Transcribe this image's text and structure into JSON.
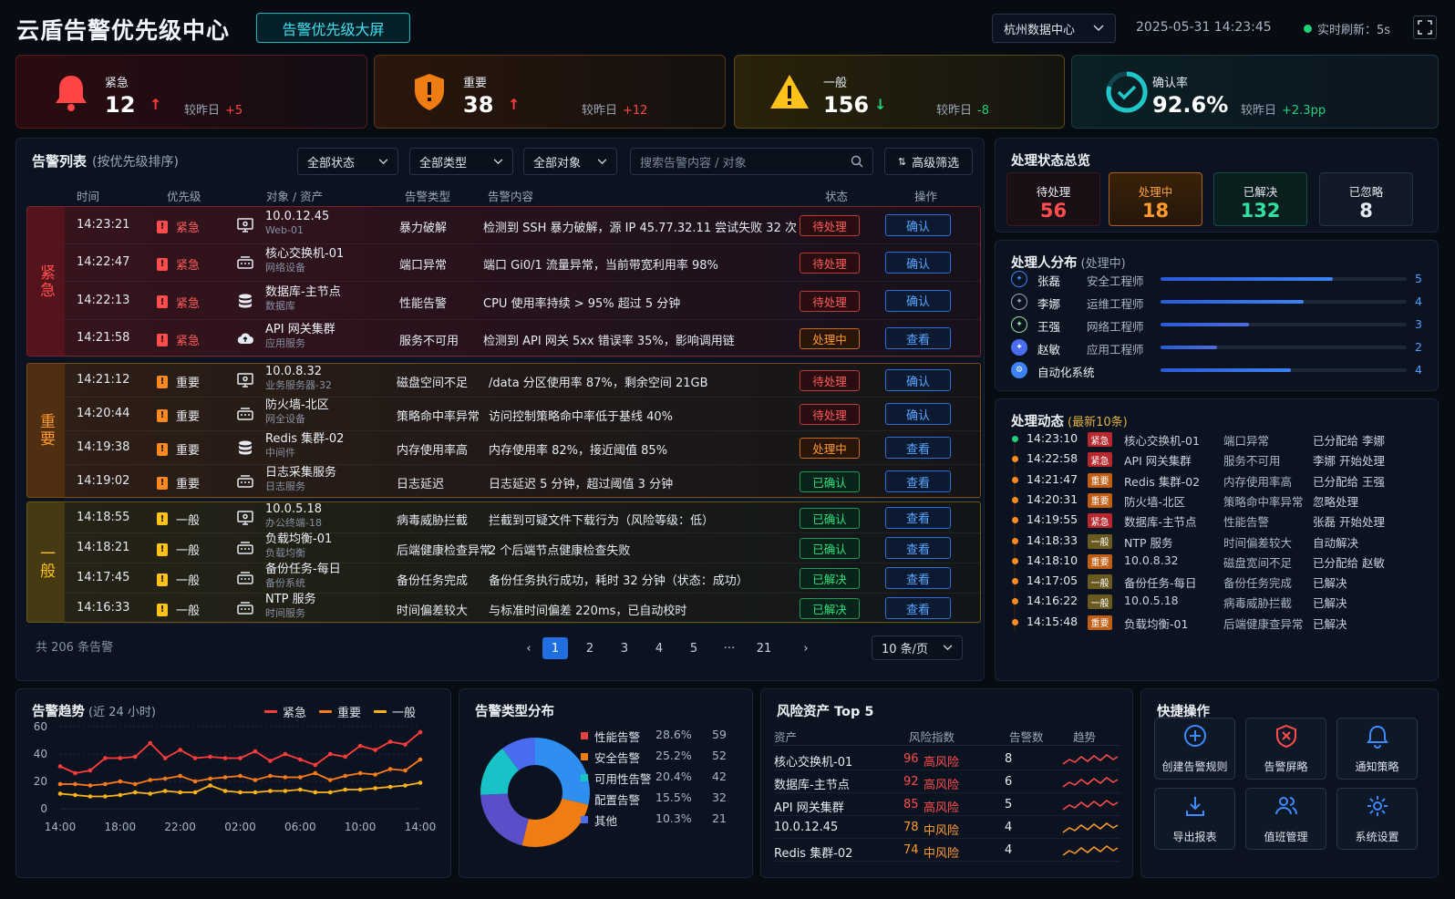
{
  "header": {
    "title": "云盾告警优先级中心",
    "badge": "告警优先级大屏",
    "datacenter": "杭州数据中心",
    "datetime": "2025-05-31 14:23:45",
    "refresh": "实时刷新：5s"
  },
  "kpis": [
    {
      "label": "紧急",
      "value": "12",
      "compare": "较昨日",
      "delta": "+5",
      "color": "#ff4d4d",
      "arrow": "↑"
    },
    {
      "label": "重要",
      "value": "38",
      "compare": "较昨日",
      "delta": "+12",
      "color": "#ff8a1f",
      "arrow": "↑"
    },
    {
      "label": "一般",
      "value": "156",
      "compare": "较昨日",
      "delta": "-8",
      "color": "#ffc21a",
      "arrow": "↓"
    },
    {
      "label": "确认率",
      "value": "92.6%",
      "compare": "较昨日",
      "delta": "+2.3pp",
      "color": "#1fc7c9",
      "arrow": ""
    }
  ],
  "alert_list": {
    "title": "告警列表",
    "subtitle": "(按优先级排序)",
    "filters": {
      "status": "全部状态",
      "type": "全部类型",
      "object": "全部对象",
      "search_placeholder": "搜索告警内容 / 对象",
      "advanced": "高级筛选"
    },
    "columns": {
      "time": "时间",
      "priority": "优先级",
      "object": "对象 / 资产",
      "type": "告警类型",
      "content": "告警内容",
      "status": "状态",
      "action": "操作"
    },
    "groups": [
      {
        "name": "紧急",
        "rows": [
          {
            "time": "14:23:21",
            "priority": "紧急",
            "object": "10.0.12.45",
            "sub": "Web-01",
            "type": "暴力破解",
            "content": "检测到 SSH 暴力破解，源 IP 45.77.32.11 尝试失败 32 次",
            "status": "待处理",
            "action": "确认"
          },
          {
            "time": "14:22:47",
            "priority": "紧急",
            "object": "核心交换机-01",
            "sub": "网络设备",
            "type": "端口异常",
            "content": "端口 Gi0/1 流量异常，当前带宽利用率 98%",
            "status": "待处理",
            "action": "确认"
          },
          {
            "time": "14:22:13",
            "priority": "紧急",
            "object": "数据库-主节点",
            "sub": "数据库",
            "type": "性能告警",
            "content": "CPU 使用率持续 > 95% 超过 5 分钟",
            "status": "待处理",
            "action": "确认"
          },
          {
            "time": "14:21:58",
            "priority": "紧急",
            "object": "API 网关集群",
            "sub": "应用服务",
            "type": "服务不可用",
            "content": "检测到 API 网关 5xx 错误率 35%，影响调用链",
            "status": "处理中",
            "action": "查看"
          }
        ]
      },
      {
        "name": "重要",
        "rows": [
          {
            "time": "14:21:12",
            "priority": "重要",
            "object": "10.0.8.32",
            "sub": "业务服务器-32",
            "type": "磁盘空间不足",
            "content": "/data 分区使用率 87%，剩余空间 21GB",
            "status": "待处理",
            "action": "确认"
          },
          {
            "time": "14:20:44",
            "priority": "重要",
            "object": "防火墙-北区",
            "sub": "网全设备",
            "type": "策略命中率异常",
            "content": "访问控制策略命中率低于基线 40%",
            "status": "待处理",
            "action": "确认"
          },
          {
            "time": "14:19:38",
            "priority": "重要",
            "object": "Redis 集群-02",
            "sub": "中间件",
            "type": "内存使用率高",
            "content": "内存使用率 82%，接近阈值 85%",
            "status": "处理中",
            "action": "查看"
          },
          {
            "time": "14:19:02",
            "priority": "重要",
            "object": "日志采集服务",
            "sub": "日志服务",
            "type": "日志延迟",
            "content": "日志延迟 5 分钟，超过阈值 3 分钟",
            "status": "已确认",
            "action": "查看"
          }
        ]
      },
      {
        "name": "一般",
        "rows": [
          {
            "time": "14:18:55",
            "priority": "一般",
            "object": "10.0.5.18",
            "sub": "办公终端-18",
            "type": "病毒威胁拦截",
            "content": "拦截到可疑文件下载行为（风险等级：低）",
            "status": "已确认",
            "action": "查看"
          },
          {
            "time": "14:18:21",
            "priority": "一般",
            "object": "负载均衡-01",
            "sub": "负载均衡",
            "type": "后端健康检查异常",
            "content": "2 个后端节点健康检查失败",
            "status": "已确认",
            "action": "查看"
          },
          {
            "time": "14:17:45",
            "priority": "一般",
            "object": "备份任务-每日",
            "sub": "备份系统",
            "type": "备份任务完成",
            "content": "备份任务执行成功，耗时 32 分钟（状态：成功）",
            "status": "已解决",
            "action": "查看"
          },
          {
            "time": "14:16:33",
            "priority": "一般",
            "object": "NTP 服务",
            "sub": "时间服务",
            "type": "时间偏差较大",
            "content": "与标准时间偏差 220ms，已自动校时",
            "status": "已解决",
            "action": "查看"
          }
        ]
      }
    ],
    "total": "共 206 条告警",
    "pages": [
      "1",
      "2",
      "3",
      "4",
      "5",
      "···",
      "21"
    ],
    "page_size": "10 条/页"
  },
  "status_overview": {
    "title": "处理状态总览",
    "items": [
      {
        "label": "待处理",
        "value": "56",
        "color": "#ff4d4d"
      },
      {
        "label": "处理中",
        "value": "18",
        "color": "#ff9a2e"
      },
      {
        "label": "已解决",
        "value": "132",
        "color": "#2fe0a0"
      },
      {
        "label": "已忽略",
        "value": "8",
        "color": "#e6ebf2"
      }
    ]
  },
  "handlers": {
    "title": "处理人分布",
    "subtitle": "(处理中)",
    "items": [
      {
        "name": "张磊",
        "role": "安全工程师",
        "count": 5,
        "fraction": 0.7,
        "color": "#3b82f6"
      },
      {
        "name": "李娜",
        "role": "运维工程师",
        "count": 4,
        "fraction": 0.58,
        "color": "#3b82f6"
      },
      {
        "name": "王强",
        "role": "网络工程师",
        "count": 3,
        "fraction": 0.36,
        "color": "#4f6bd8"
      },
      {
        "name": "赵敏",
        "role": "应用工程师",
        "count": 2,
        "fraction": 0.23,
        "color": "#4f6bd8"
      },
      {
        "name": "自动化系统",
        "role": "",
        "count": 4,
        "fraction": 0.53,
        "color": "#3b82f6"
      }
    ]
  },
  "activity": {
    "title": "处理动态",
    "subtitle": "(最新10条)",
    "items": [
      {
        "time": "14:23:10",
        "tag": "紧急",
        "object": "核心交换机-01",
        "type": "端口异常",
        "action": "已分配给 李娜"
      },
      {
        "time": "14:22:58",
        "tag": "紧急",
        "object": "API 网关集群",
        "type": "服务不可用",
        "action": "李娜 开始处理"
      },
      {
        "time": "14:21:47",
        "tag": "重要",
        "object": "Redis 集群-02",
        "type": "内存使用率高",
        "action": "已分配给 王强"
      },
      {
        "time": "14:20:31",
        "tag": "重要",
        "object": "防火墙-北区",
        "type": "策略命中率异常",
        "action": "忽略处理"
      },
      {
        "time": "14:19:55",
        "tag": "紧急",
        "object": "数据库-主节点",
        "type": "性能告警",
        "action": "张磊 开始处理"
      },
      {
        "time": "14:18:33",
        "tag": "一般",
        "object": "NTP 服务",
        "type": "时间偏差较大",
        "action": "自动解决"
      },
      {
        "time": "14:18:10",
        "tag": "重要",
        "object": "10.0.8.32",
        "type": "磁盘宽间不足",
        "action": "已分配给 赵敏"
      },
      {
        "time": "14:17:05",
        "tag": "一般",
        "object": "备份任务-每日",
        "type": "备份任务完成",
        "action": "已解决"
      },
      {
        "time": "14:16:22",
        "tag": "一般",
        "object": "10.0.5.18",
        "type": "病毒威胁拦截",
        "action": "已解决"
      },
      {
        "time": "14:15:48",
        "tag": "重要",
        "object": "负载均衡-01",
        "type": "后端健康查异常",
        "action": "已解决"
      }
    ]
  },
  "trend": {
    "title": "告警趋势",
    "subtitle": "(近 24 小时)"
  },
  "type_dist": {
    "title": "告警类型分布",
    "items": [
      {
        "name": "性能告警",
        "pct": "28.6%",
        "count": "59",
        "color": "#2f8ff0"
      },
      {
        "name": "安全告警",
        "pct": "25.2%",
        "count": "52",
        "color": "#f07d12"
      },
      {
        "name": "可用性告警",
        "pct": "20.4%",
        "count": "42",
        "color": "#5a4fc8"
      },
      {
        "name": "配置告警",
        "pct": "15.5%",
        "count": "32",
        "color": "#18c3c8"
      },
      {
        "name": "其他",
        "pct": "10.3%",
        "count": "21",
        "color": "#4a6cf0"
      }
    ]
  },
  "risk": {
    "title": "风险资产 Top 5",
    "columns": {
      "asset": "资产",
      "index": "风险指数",
      "count": "告警数",
      "trend": "趋势"
    },
    "items": [
      {
        "asset": "核心交换机-01",
        "index": "96",
        "level": "高风险",
        "count": "8",
        "color": "#ff4d4d"
      },
      {
        "asset": "数据库-主节点",
        "index": "92",
        "level": "高风险",
        "count": "6",
        "color": "#ff4d4d"
      },
      {
        "asset": "API 网关集群",
        "index": "85",
        "level": "高风险",
        "count": "5",
        "color": "#ff4d4d"
      },
      {
        "asset": "10.0.12.45",
        "index": "78",
        "level": "中风险",
        "count": "4",
        "color": "#ff9a2e"
      },
      {
        "asset": "Redis 集群-02",
        "index": "74",
        "level": "中风险",
        "count": "4",
        "color": "#ff9a2e"
      }
    ]
  },
  "quick": {
    "title": "快捷操作",
    "items": [
      {
        "label": "创建告警规则",
        "icon": "plus-circle-icon"
      },
      {
        "label": "告警屏略",
        "icon": "shield-x-icon"
      },
      {
        "label": "通知策略",
        "icon": "bell-icon"
      },
      {
        "label": "导出报表",
        "icon": "download-icon"
      },
      {
        "label": "值班管理",
        "icon": "users-icon"
      },
      {
        "label": "系统设置",
        "icon": "gear-icon"
      }
    ]
  },
  "chart_data": [
    {
      "type": "line",
      "title": "告警趋势",
      "subtitle": "(近 24 小时)",
      "x": [
        "14:00",
        "16:00",
        "18:00",
        "20:00",
        "22:00",
        "00:00",
        "02:00",
        "04:00",
        "06:00",
        "08:00",
        "10:00",
        "12:00",
        "14:00"
      ],
      "xticks": [
        "14:00",
        "18:00",
        "22:00",
        "02:00",
        "06:00",
        "10:00",
        "14:00"
      ],
      "ylim": [
        0,
        60
      ],
      "yticks": [
        0,
        20,
        40,
        60
      ],
      "series": [
        {
          "name": "紧急",
          "color": "#ff3b3b",
          "values": [
            31,
            26,
            28,
            37,
            37,
            38,
            48,
            37,
            43,
            37,
            38,
            37,
            37,
            42,
            35,
            40,
            36,
            32,
            40,
            38,
            46,
            43,
            49,
            47,
            56
          ]
        },
        {
          "name": "重要",
          "color": "#ff7a1a",
          "values": [
            18,
            18,
            17,
            18,
            20,
            18,
            21,
            22,
            24,
            20,
            22,
            23,
            24,
            21,
            24,
            23,
            23,
            26,
            21,
            24,
            26,
            25,
            29,
            28,
            36
          ]
        },
        {
          "name": "一般",
          "color": "#ffb31a",
          "values": [
            11,
            10,
            9,
            9,
            10,
            12,
            11,
            13,
            12,
            12,
            17,
            13,
            12,
            12,
            13,
            13,
            14,
            12,
            12,
            14,
            14,
            15,
            16,
            17,
            19
          ]
        }
      ]
    },
    {
      "type": "pie",
      "title": "告警类型分布",
      "categories": [
        "性能告警",
        "安全告警",
        "可用性告警",
        "配置告警",
        "其他"
      ],
      "values": [
        59,
        52,
        42,
        32,
        21
      ],
      "percentages": [
        "28.6%",
        "25.2%",
        "20.4%",
        "15.5%",
        "10.3%"
      ]
    }
  ]
}
